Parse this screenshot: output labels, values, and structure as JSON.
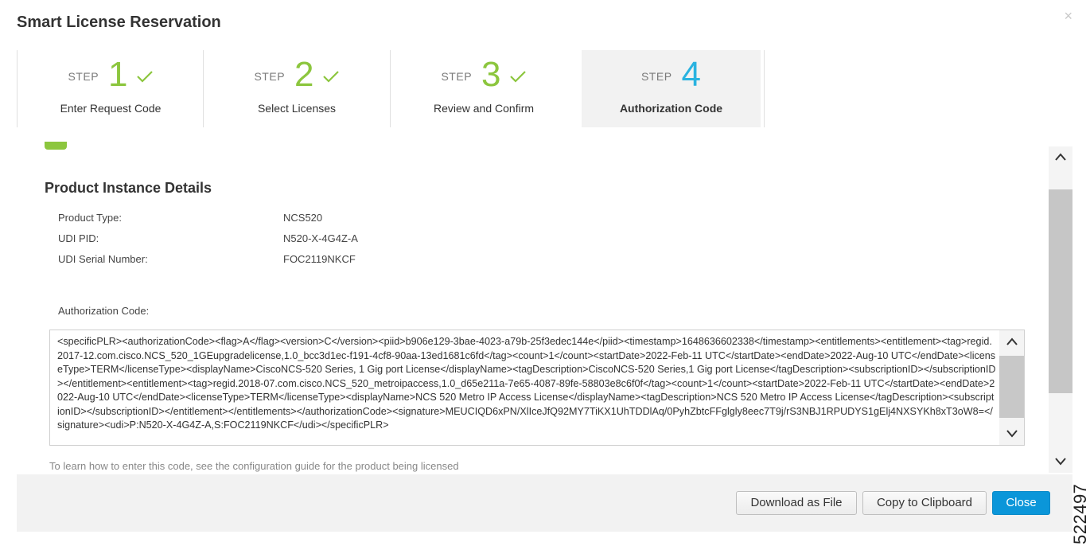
{
  "dialog": {
    "title": "Smart License Reservation",
    "close_glyph": "×"
  },
  "steps": [
    {
      "word": "STEP",
      "number": "1",
      "label": "Enter Request Code",
      "completed": true,
      "active": false
    },
    {
      "word": "STEP",
      "number": "2",
      "label": "Select Licenses",
      "completed": true,
      "active": false
    },
    {
      "word": "STEP",
      "number": "3",
      "label": "Review and Confirm",
      "completed": true,
      "active": false
    },
    {
      "word": "STEP",
      "number": "4",
      "label": "Authorization Code",
      "completed": false,
      "active": true
    }
  ],
  "details": {
    "title": "Product Instance Details",
    "rows": [
      {
        "label": "Product Type:",
        "value": "NCS520"
      },
      {
        "label": "UDI PID:",
        "value": "N520-X-4G4Z-A"
      },
      {
        "label": "UDI Serial Number:",
        "value": "FOC2119NKCF"
      }
    ]
  },
  "authorization": {
    "label": "Authorization Code:",
    "code": "<specificPLR><authorizationCode><flag>A</flag><version>C</version><piid>b906e129-3bae-4023-a79b-25f3edec144e</piid><timestamp>1648636602338</timestamp><entitlements><entitlement><tag>regid.2017-12.com.cisco.NCS_520_1GEupgradelicense,1.0_bcc3d1ec-f191-4cf8-90aa-13ed1681c6fd</tag><count>1</count><startDate>2022-Feb-11 UTC</startDate><endDate>2022-Aug-10 UTC</endDate><licenseType>TERM</licenseType><displayName>CiscoNCS-520 Series, 1 Gig port License</displayName><tagDescription>CiscoNCS-520 Series,1 Gig port License</tagDescription><subscriptionID></subscriptionID></entitlement><entitlement><tag>regid.2018-07.com.cisco.NCS_520_metroipaccess,1.0_d65e211a-7e65-4087-89fe-58803e8c6f0f</tag><count>1</count><startDate>2022-Feb-11 UTC</startDate><endDate>2022-Aug-10 UTC</endDate><licenseType>TERM</licenseType><displayName>NCS 520 Metro IP Access License</displayName><tagDescription>NCS 520 Metro IP Access License</tagDescription><subscriptionID></subscriptionID></entitlement></entitlements></authorizationCode><signature>MEUCIQD6xPN/XlIceJfQ92MY7TiKX1UhTDDlAq/0PyhZbtcFFglgly8eec7T9j/rS3NBJ1RPUDYS1gElj4NXSYKh8xT3oW8=</signature><udi>P:N520-X-4G4Z-A,S:FOC2119NKCF</udi></specificPLR>",
    "hint": "To learn how to enter this code, see the configuration guide for the product being licensed"
  },
  "footer": {
    "download_label": "Download as File",
    "copy_label": "Copy to Clipboard",
    "close_label": "Close"
  },
  "figure_number": "522497",
  "icons": {
    "check": "check-icon",
    "scroll_up": "chevron-up-icon",
    "scroll_down": "chevron-down-icon",
    "close": "close-icon"
  },
  "colors": {
    "step_done": "#8cc63e",
    "step_active": "#2ab3e0",
    "primary_button": "#0b96d9"
  }
}
